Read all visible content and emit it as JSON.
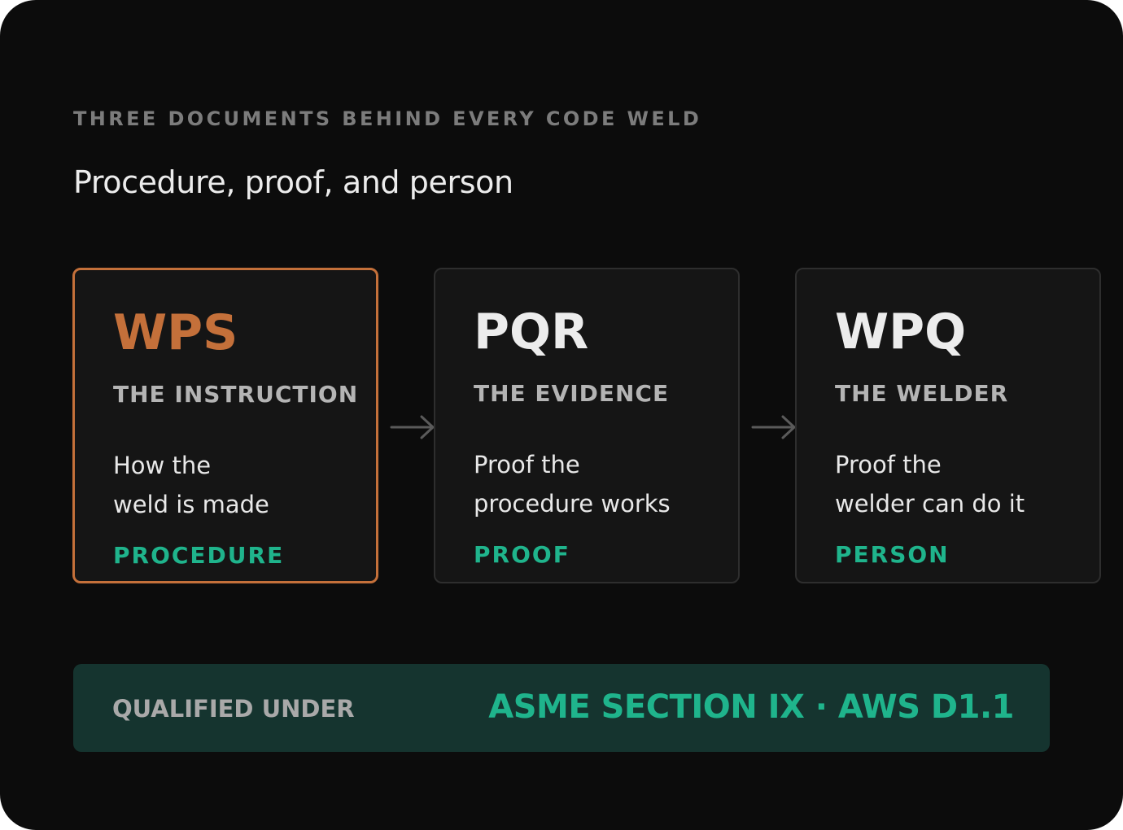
{
  "eyebrow": "THREE DOCUMENTS BEHIND EVERY CODE WELD",
  "headline": "Procedure, proof, and person",
  "documents": [
    {
      "abbr": "WPS",
      "role": "THE INSTRUCTION",
      "description": "How the\nweld is made",
      "tag": "PROCEDURE",
      "highlighted": true
    },
    {
      "abbr": "PQR",
      "role": "THE EVIDENCE",
      "description": "Proof the\nprocedure works",
      "tag": "PROOF",
      "highlighted": false
    },
    {
      "abbr": "WPQ",
      "role": "THE WELDER",
      "description": "Proof the\nwelder can do it",
      "tag": "PERSON",
      "highlighted": false
    }
  ],
  "flow_connector_icon": "arrow-right-icon",
  "footer": {
    "label": "QUALIFIED UNDER",
    "standards": "ASME SECTION IX · AWS D1.1"
  },
  "colors": {
    "background": "#0c0c0c",
    "card": "#151515",
    "highlight": "#c4703a",
    "accent_green": "#1fb48c",
    "footer_bg": "#15342f"
  }
}
